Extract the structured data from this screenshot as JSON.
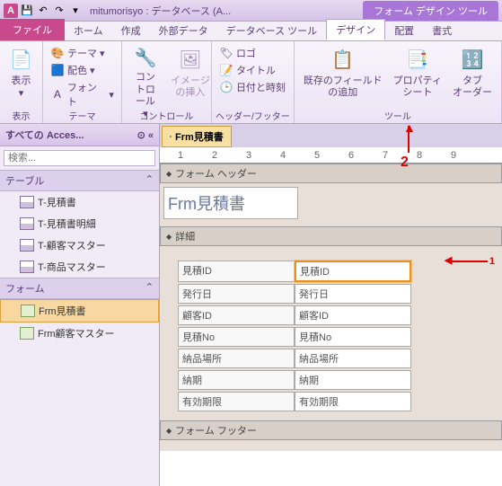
{
  "titlebar": {
    "app_icon": "A",
    "title": "mitumorisyo : データベース (A...",
    "tool_tab": "フォーム デザイン ツール"
  },
  "tabs": {
    "file": "ファイル",
    "home": "ホーム",
    "create": "作成",
    "external": "外部データ",
    "dbtools": "データベース ツール",
    "design": "デザイン",
    "arrange": "配置",
    "format": "書式"
  },
  "ribbon": {
    "view": {
      "label": "表示",
      "group": "表示"
    },
    "themes": {
      "theme": "テーマ",
      "colors": "配色",
      "fonts": "フォント",
      "group": "テーマ"
    },
    "controls": {
      "label": "コントロール",
      "group": "コントロール"
    },
    "image": {
      "label": "イメージ\nの挿入"
    },
    "header": {
      "logo": "ロゴ",
      "title": "タイトル",
      "datetime": "日付と時刻",
      "group": "ヘッダー/フッター"
    },
    "tools": {
      "addfields": "既存のフィールド\nの追加",
      "propsheet": "プロパティ\nシート",
      "taborder": "タブ\nオーダー",
      "group": "ツール"
    }
  },
  "nav": {
    "header": "すべての Acces...",
    "search_placeholder": "検索...",
    "group_tables": "テーブル",
    "group_forms": "フォーム",
    "tables": [
      "T-見積書",
      "T-見積書明細",
      "T-顧客マスター",
      "T-商品マスター"
    ],
    "forms": [
      "Frm見積書",
      "Frm顧客マスター"
    ]
  },
  "design_tab": "Frm見積書",
  "sections": {
    "header": "フォーム ヘッダー",
    "detail": "詳細",
    "footer": "フォーム フッター"
  },
  "form_title": "Frm見積書",
  "fields": [
    {
      "label": "見積ID",
      "control": "見積ID"
    },
    {
      "label": "発行日",
      "control": "発行日"
    },
    {
      "label": "顧客ID",
      "control": "顧客ID"
    },
    {
      "label": "見積No",
      "control": "見積No"
    },
    {
      "label": "納品場所",
      "control": "納品場所"
    },
    {
      "label": "納期",
      "control": "納期"
    },
    {
      "label": "有効期限",
      "control": "有効期限"
    }
  ],
  "annotations": {
    "one": "1",
    "two": "2"
  }
}
